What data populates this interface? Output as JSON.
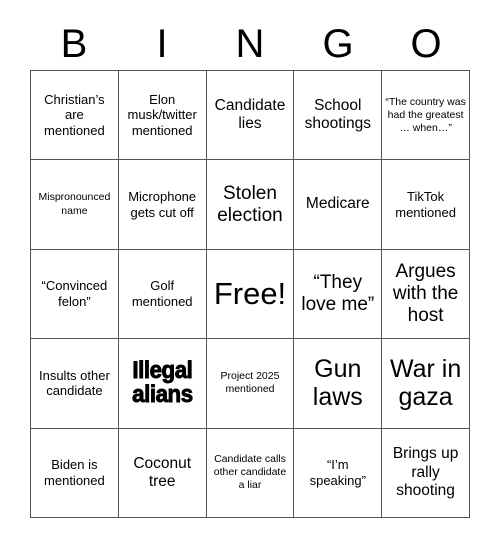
{
  "card": {
    "header_letters": [
      "B",
      "I",
      "N",
      "G",
      "O"
    ],
    "rows": 5,
    "columns": 5,
    "border_color": "#555555",
    "background_color": "#ffffff",
    "text_color": "#000000",
    "cells": [
      {
        "text": "Christian’s are mentioned",
        "size": "s",
        "style": "normal"
      },
      {
        "text": "Elon musk/twitter mentioned",
        "size": "s",
        "style": "normal"
      },
      {
        "text": "Candidate lies",
        "size": "m",
        "style": "normal"
      },
      {
        "text": "School shootings",
        "size": "m",
        "style": "normal"
      },
      {
        "text": "“The country was had the greatest … when…”",
        "size": "xs",
        "style": "normal"
      },
      {
        "text": "Mispronounced name",
        "size": "xs",
        "style": "normal"
      },
      {
        "text": "Microphone gets cut off",
        "size": "s",
        "style": "normal"
      },
      {
        "text": "Stolen election",
        "size": "l",
        "style": "normal"
      },
      {
        "text": "Medicare",
        "size": "m",
        "style": "normal"
      },
      {
        "text": "TikTok mentioned",
        "size": "s",
        "style": "normal"
      },
      {
        "text": "“Convinced felon”",
        "size": "s",
        "style": "normal"
      },
      {
        "text": "Golf mentioned",
        "size": "s",
        "style": "normal"
      },
      {
        "text": "Free!",
        "size": "xxl",
        "style": "free"
      },
      {
        "text": "“They love me”",
        "size": "l",
        "style": "normal"
      },
      {
        "text": "Argues with the host",
        "size": "l",
        "style": "normal"
      },
      {
        "text": "Insults other candidate",
        "size": "s",
        "style": "normal"
      },
      {
        "text": "Illegal alians",
        "size": "l",
        "style": "heavy"
      },
      {
        "text": "Project 2025 mentioned",
        "size": "xs",
        "style": "normal"
      },
      {
        "text": "Gun laws",
        "size": "xl",
        "style": "normal"
      },
      {
        "text": "War in gaza",
        "size": "xl",
        "style": "normal"
      },
      {
        "text": "Biden is mentioned",
        "size": "s",
        "style": "normal"
      },
      {
        "text": "Coconut tree",
        "size": "m",
        "style": "normal"
      },
      {
        "text": "Candidate calls other candidate a liar",
        "size": "xs",
        "style": "normal"
      },
      {
        "text": "“I’m speaking”",
        "size": "s",
        "style": "normal"
      },
      {
        "text": "Brings up rally shooting",
        "size": "m",
        "style": "normal"
      }
    ]
  }
}
